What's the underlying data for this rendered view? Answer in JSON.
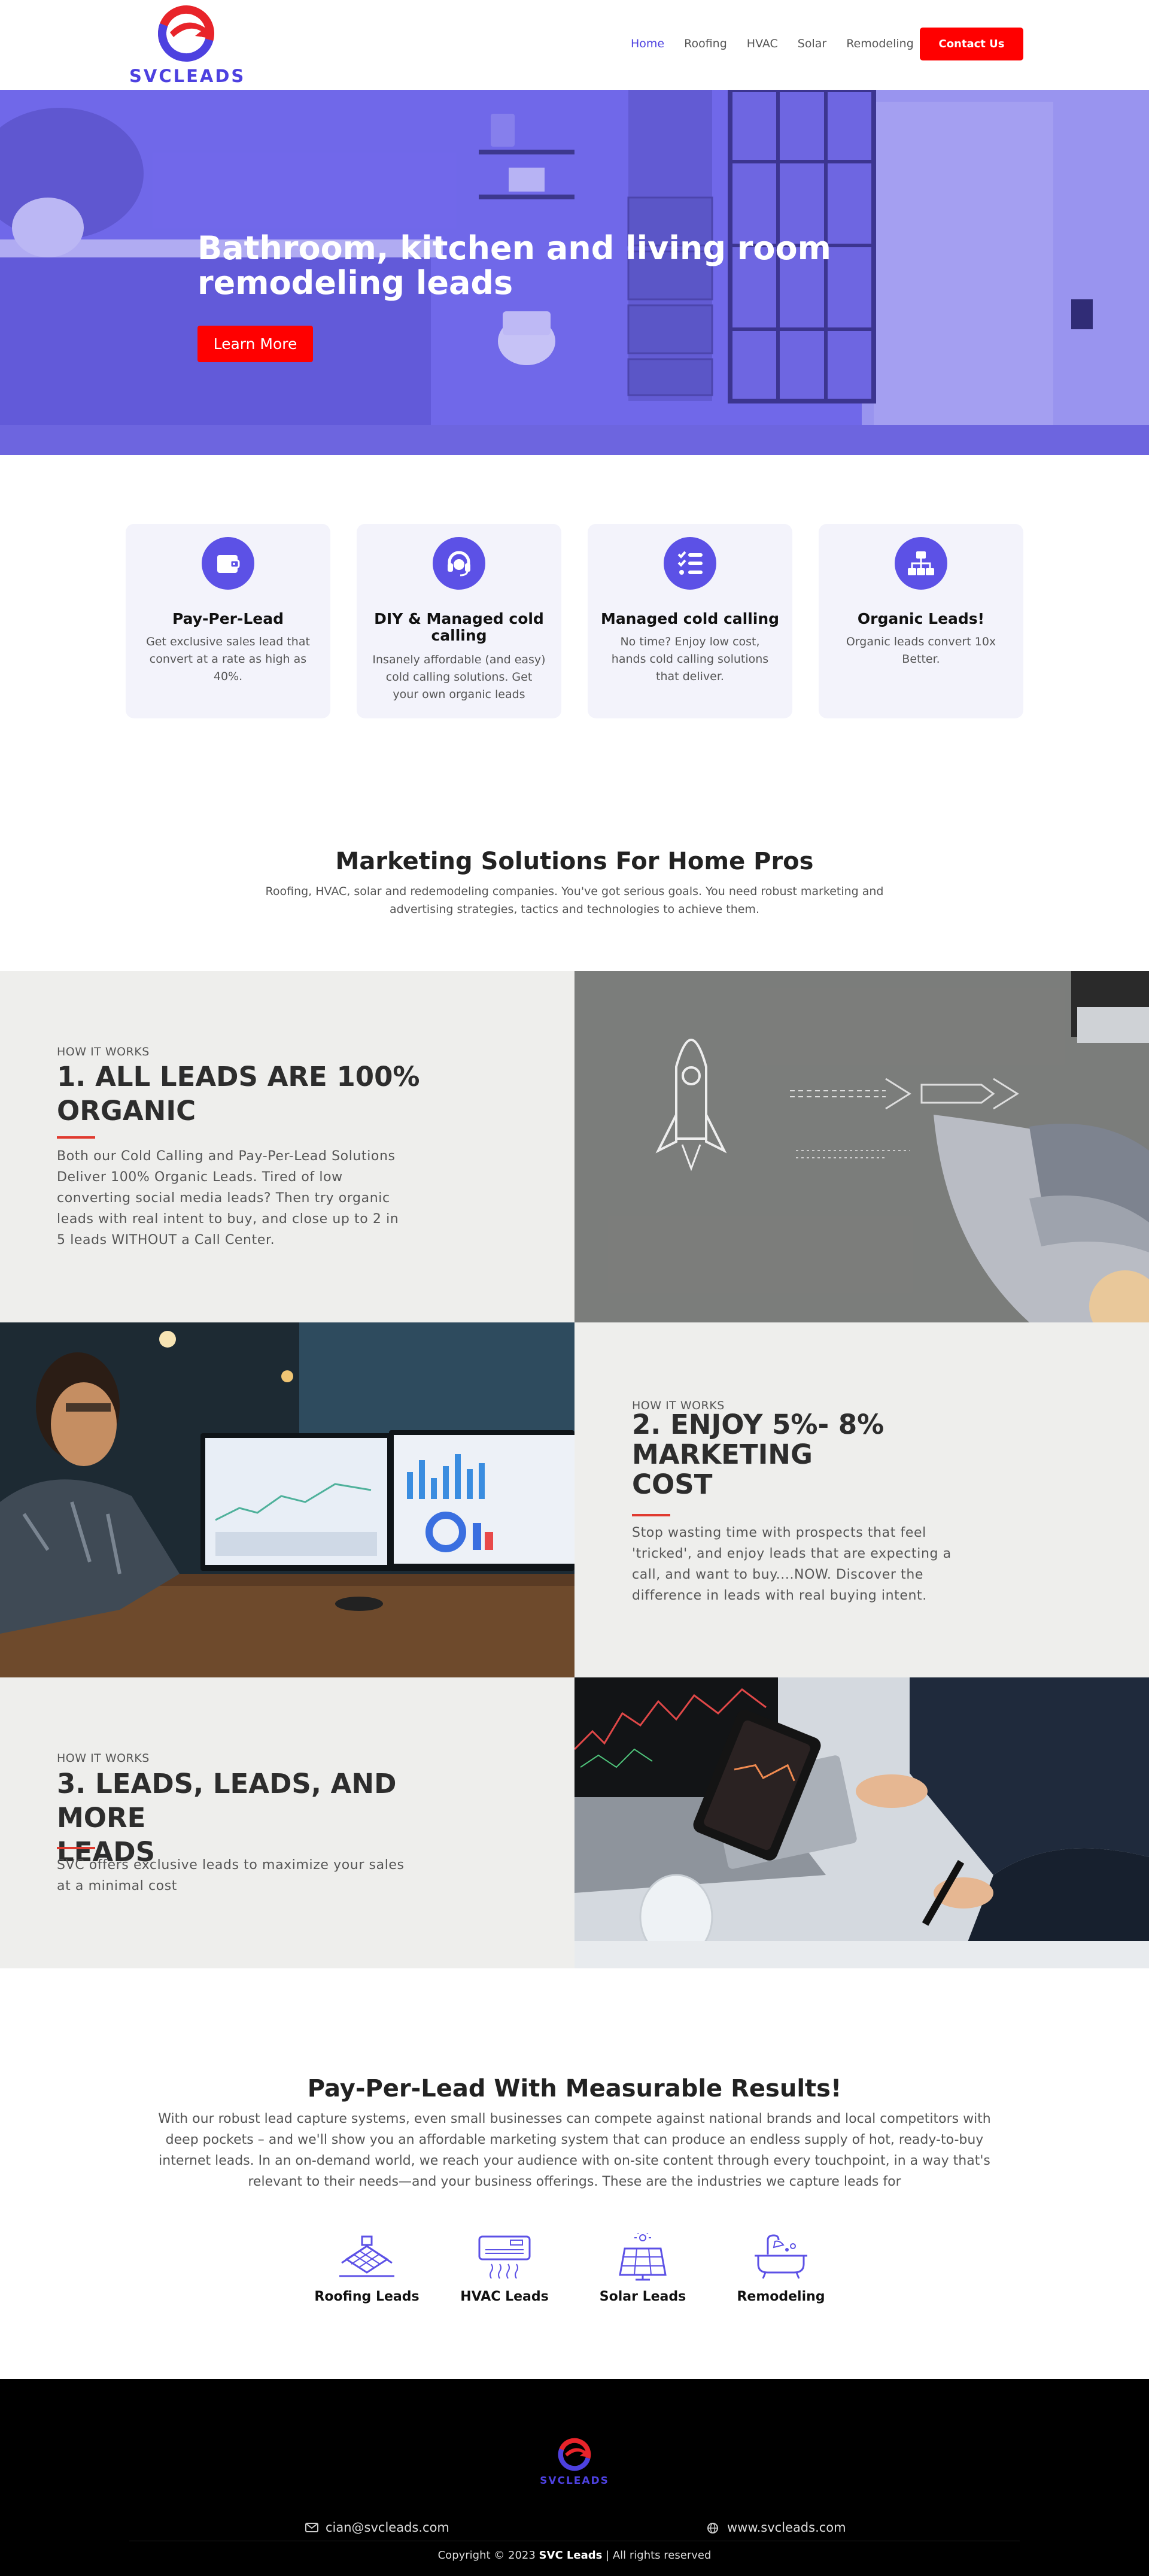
{
  "header": {
    "logo_text": "SVCLEADS",
    "nav": [
      "Home",
      "Roofing",
      "HVAC",
      "Solar",
      "Remodeling"
    ],
    "active_nav": "Home",
    "contact_label": "Contact Us"
  },
  "hero": {
    "title": "Bathroom, kitchen and living room remodeling leads",
    "button_label": "Learn More"
  },
  "features": [
    {
      "icon": "wallet-icon",
      "title": "Pay-Per-Lead",
      "text": "Get exclusive sales lead that convert at a rate as high as 40%."
    },
    {
      "icon": "headset-icon",
      "title": "DIY & Managed cold calling",
      "text": "Insanely affordable (and easy) cold calling solutions. Get your own organic leads"
    },
    {
      "icon": "checklist-icon",
      "title": "Managed cold calling",
      "text": "No time? Enjoy low cost, hands cold calling solutions that deliver."
    },
    {
      "icon": "sitemap-icon",
      "title": "Organic Leads!",
      "text": "Organic leads convert 10x Better."
    }
  ],
  "marketing": {
    "title": "Marketing Solutions For Home Pros",
    "subtitle": "Roofing, HVAC, solar and redemodeling companies. You've got serious goals. You need robust marketing and advertising strategies, tactics and technologies to achieve them."
  },
  "how_it_works": [
    {
      "kicker": "HOW IT WORKS",
      "title_lines": [
        "1. ALL LEADS ARE 100%",
        "ORGANIC"
      ],
      "text_lines": [
        "Both our Cold Calling and Pay-Per-Lead Solutions",
        "Deliver 100% Organic Leads. Tired of low",
        "converting social media leads? Then try organic",
        "leads with real intent to buy, and close up to 2 in",
        "5 leads WITHOUT a Call Center."
      ]
    },
    {
      "kicker": "HOW IT WORKS",
      "title_lines": [
        "2. ENJOY 5%- 8%",
        "MARKETING",
        "COST"
      ],
      "text_lines": [
        "Stop wasting time with prospects that feel",
        "'tricked', and enjoy leads that are expecting a",
        "call, and want to buy....NOW. Discover the",
        "difference in leads with real buying intent."
      ]
    },
    {
      "kicker": "HOW IT WORKS",
      "title_lines": [
        "3. LEADS, LEADS, AND MORE",
        "LEADS"
      ],
      "text_lines": [
        "SVC offers exclusive leads to maximize your sales",
        "at a minimal cost"
      ]
    }
  ],
  "ppl": {
    "title": "Pay-Per-Lead With Measurable Results!",
    "text": "With our robust lead capture systems, even small businesses can compete against national brands and local competitors with deep pockets – and we'll show you an affordable marketing system that can produce an endless supply of hot, ready-to-buy internet leads. In an on-demand world, we reach your audience with on-site content through every touchpoint, in a way that's relevant to their needs—and your business offerings. These are the industries we capture leads for",
    "industries": [
      {
        "icon": "roofing-icon",
        "label": "Roofing Leads"
      },
      {
        "icon": "hvac-icon",
        "label": "HVAC Leads"
      },
      {
        "icon": "solar-panel-icon",
        "label": "Solar Leads"
      },
      {
        "icon": "bathtub-icon",
        "label": "Remodeling"
      }
    ]
  },
  "footer": {
    "logo_text": "SVCLEADS",
    "email": "cian@svcleads.com",
    "website": "www.svcleads.com",
    "copyright_prefix": "Copyright © 2023 ",
    "copyright_brand": "SVC Leads",
    "copyright_suffix": " | All rights reserved"
  },
  "colors": {
    "brand": "#4d41e0",
    "accent_red": "#ff0000",
    "hero_overlay": "#6f66e8",
    "card_bg": "#f3f3fb",
    "section_gray": "#eeeeec",
    "footer_bg": "#000000"
  }
}
